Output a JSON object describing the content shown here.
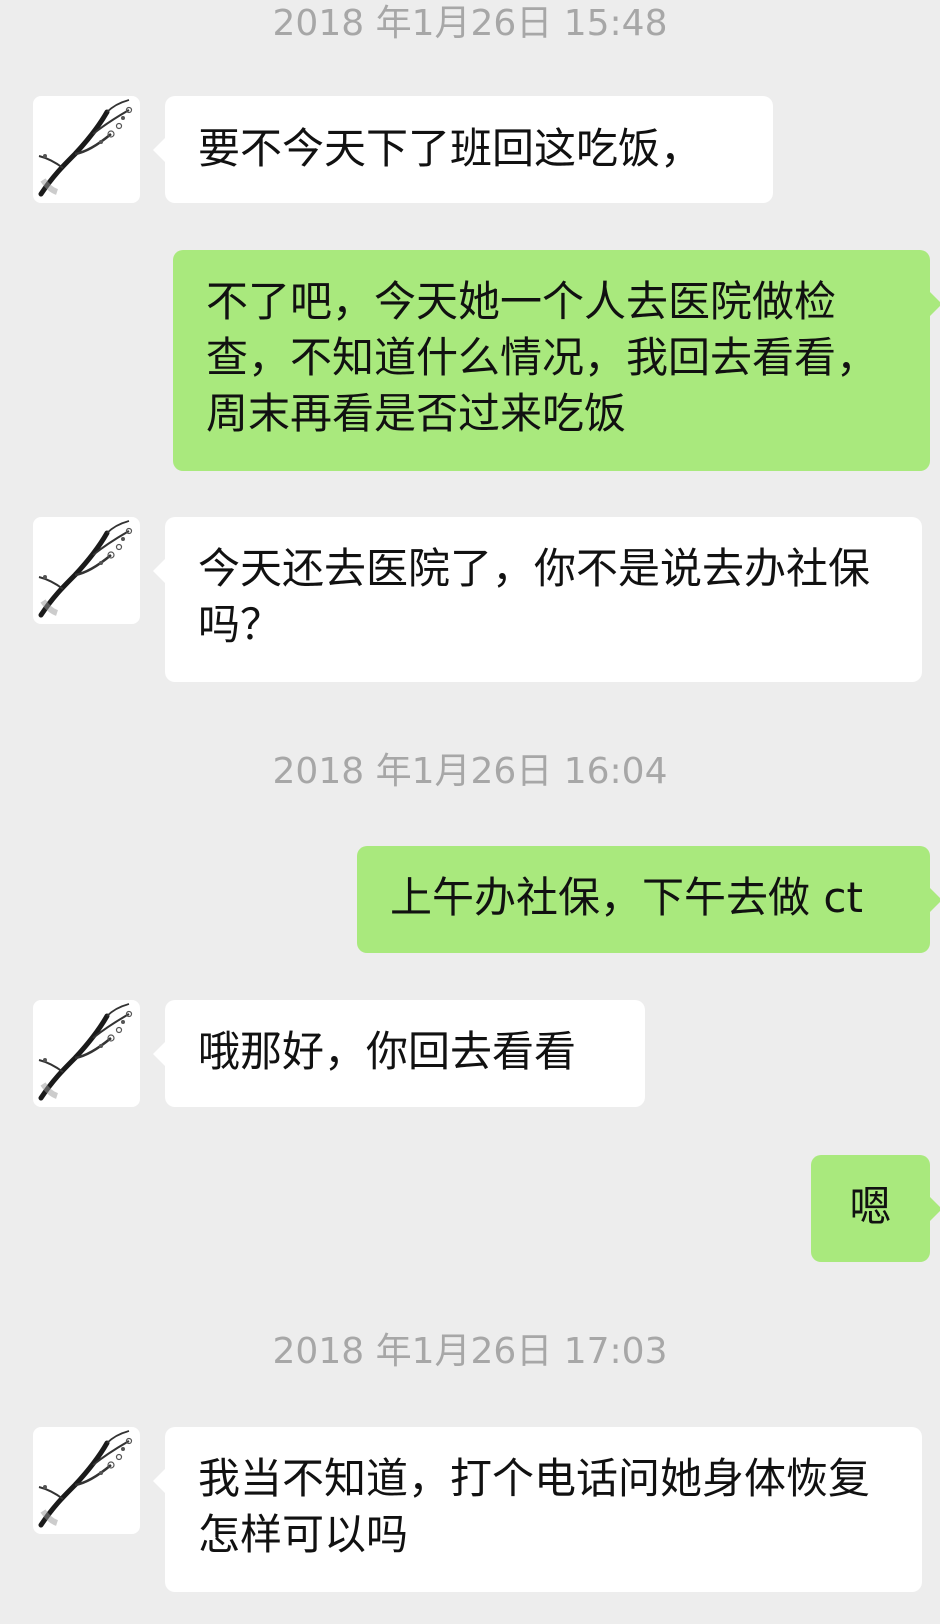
{
  "chat": {
    "timestamps": [
      "2018 年1月26日 15:48",
      "2018 年1月26日 16:04",
      "2018 年1月26日 17:03"
    ],
    "messages": [
      {
        "from": "other",
        "text": "要不今天下了班回这吃饭，"
      },
      {
        "from": "me",
        "text": "不了吧，今天她一个人去医院做检查，不知道什么情况，我回去看看，周末再看是否过来吃饭"
      },
      {
        "from": "other",
        "text": "今天还去医院了，你不是说去办社保吗？"
      },
      {
        "from": "me",
        "text": "上午办社保，下午去做 ct"
      },
      {
        "from": "other",
        "text": "哦那好，你回去看看"
      },
      {
        "from": "me",
        "text": "嗯"
      },
      {
        "from": "other",
        "text": "我当不知道，打个电话问她身体恢复怎样可以吗"
      }
    ]
  },
  "avatar": {
    "icon": "plum-blossom-branch-icon"
  },
  "colors": {
    "background": "#ededed",
    "incoming_bubble": "#ffffff",
    "outgoing_bubble": "#a9e97d",
    "timestamp_text": "#a7a7a7"
  }
}
